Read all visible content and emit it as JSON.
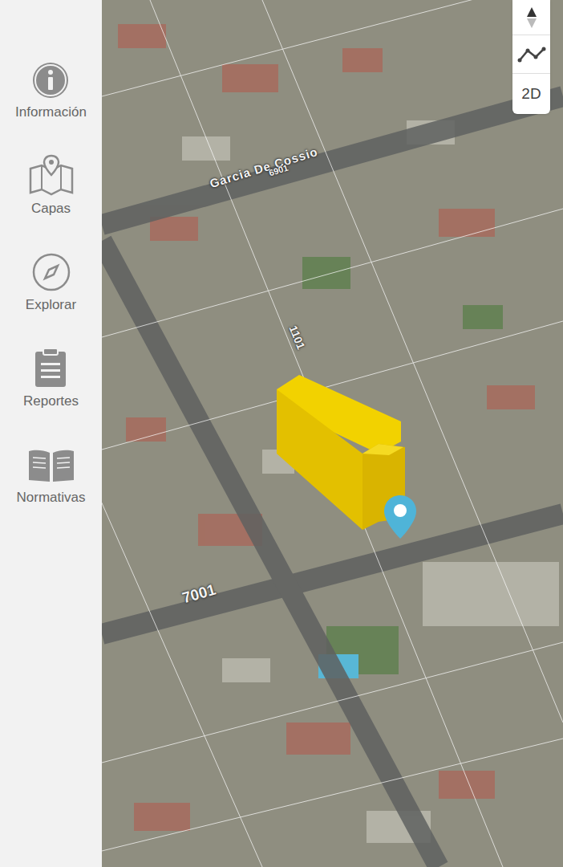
{
  "sidebar": {
    "items": [
      {
        "label": "Información"
      },
      {
        "label": "Capas"
      },
      {
        "label": "Explorar"
      },
      {
        "label": "Reportes"
      },
      {
        "label": "Normativas"
      }
    ]
  },
  "map_controls": {
    "view_toggle": "2D"
  },
  "map": {
    "street_labels": [
      {
        "text": "Garcia De Cossio"
      },
      {
        "text": "6901"
      },
      {
        "text": "1101"
      },
      {
        "text": "7001"
      }
    ]
  }
}
